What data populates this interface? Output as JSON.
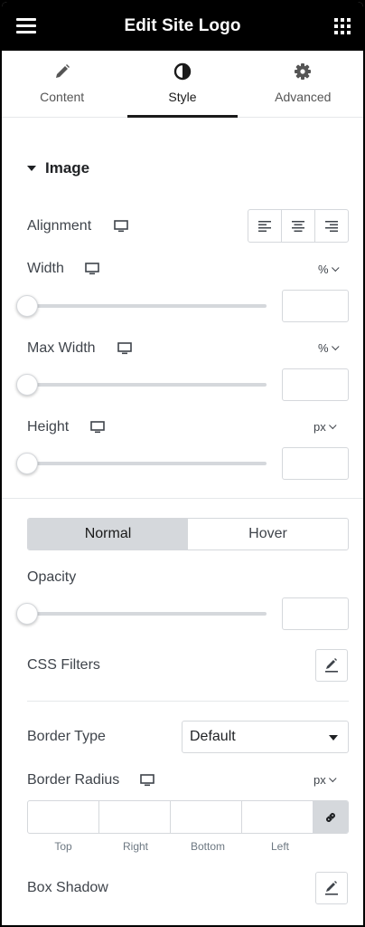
{
  "header": {
    "title": "Edit Site Logo"
  },
  "tabs": [
    {
      "label": "Content",
      "icon": "pencil-icon"
    },
    {
      "label": "Style",
      "icon": "contrast-icon",
      "active": true
    },
    {
      "label": "Advanced",
      "icon": "gear-icon"
    }
  ],
  "image_section": {
    "title": "Image",
    "alignment_label": "Alignment",
    "width_label": "Width",
    "width_unit": "%",
    "max_width_label": "Max Width",
    "max_width_unit": "%",
    "height_label": "Height",
    "height_unit": "px"
  },
  "state_toggle": {
    "normal": "Normal",
    "hover": "Hover",
    "selected": "Normal"
  },
  "opacity_label": "Opacity",
  "css_filters_label": "CSS Filters",
  "border": {
    "type_label": "Border Type",
    "type_value": "Default",
    "radius_label": "Border Radius",
    "radius_unit": "px",
    "top": "Top",
    "right": "Right",
    "bottom": "Bottom",
    "left": "Left"
  },
  "box_shadow_label": "Box Shadow",
  "sliders": {
    "width": 0,
    "max_width": 0,
    "height": 0,
    "opacity": 0
  },
  "colors": {
    "header_bg": "#000000",
    "active_toggle": "#d5d8dc",
    "border": "#d5d8dc"
  }
}
